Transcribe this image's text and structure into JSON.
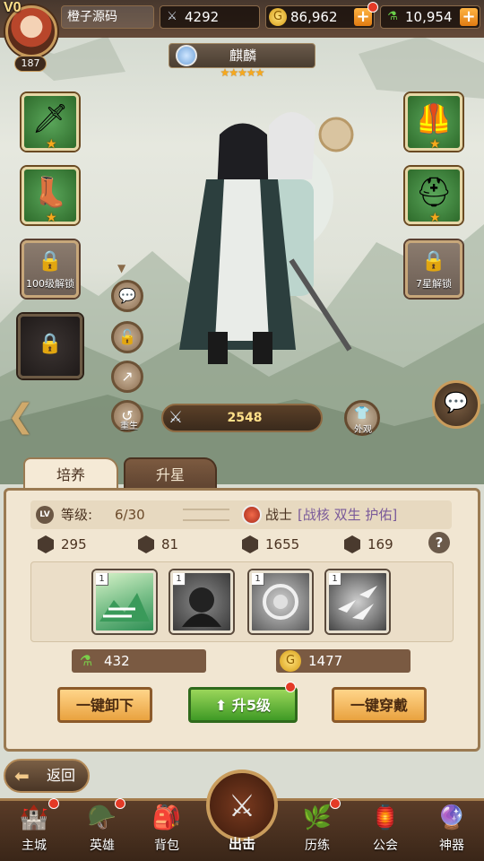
{
  "header": {
    "vip": "V0",
    "player_name": "橙子源码",
    "player_level": "187",
    "power": "4292",
    "gold": "86,962",
    "potion": "10,954"
  },
  "hero": {
    "name": "麒麟",
    "stars": "★★★★★",
    "star_count": 5,
    "combat_power": "2548"
  },
  "equipment": {
    "left_top_icon": "sword-icon",
    "left_mid_icon": "boots-icon",
    "right_top_icon": "armor-icon",
    "right_mid_icon": "helmet-icon",
    "left_locked_text": "100级解锁",
    "right_locked_text": "7星解锁"
  },
  "side_actions": {
    "rebirth_label": "重生",
    "skin_label": "外观"
  },
  "tabs": {
    "train": "培养",
    "star_up": "升星"
  },
  "info": {
    "level_label": "等级:",
    "level_value": "6/30",
    "class_name": "战士",
    "class_tags": "[战核 双生 护佑]",
    "lv_icon": "LV"
  },
  "stats": [
    {
      "icon": "attack-icon",
      "value": "295"
    },
    {
      "icon": "defense-icon",
      "value": "81"
    },
    {
      "icon": "hp-icon",
      "value": "1655"
    },
    {
      "icon": "speed-icon",
      "value": "169"
    }
  ],
  "skills": [
    {
      "level": "1",
      "icon": "mountain-skill-icon"
    },
    {
      "level": "1",
      "icon": "shadow-skill-icon"
    },
    {
      "level": "1",
      "icon": "aura-skill-icon"
    },
    {
      "level": "1",
      "icon": "birds-skill-icon"
    }
  ],
  "costs": {
    "potion": "432",
    "gold": "1477"
  },
  "actions": {
    "unequip_all": "一键卸下",
    "level_up": "升5级",
    "equip_all": "一键穿戴"
  },
  "nav": {
    "return": "返回",
    "items": [
      "主城",
      "英雄",
      "背包",
      "出击",
      "历练",
      "公会",
      "神器"
    ]
  },
  "colors": {
    "accent_gold": "#f7a91c",
    "notify_red": "#e43a26",
    "panel_bg": "#f1e6d2"
  }
}
